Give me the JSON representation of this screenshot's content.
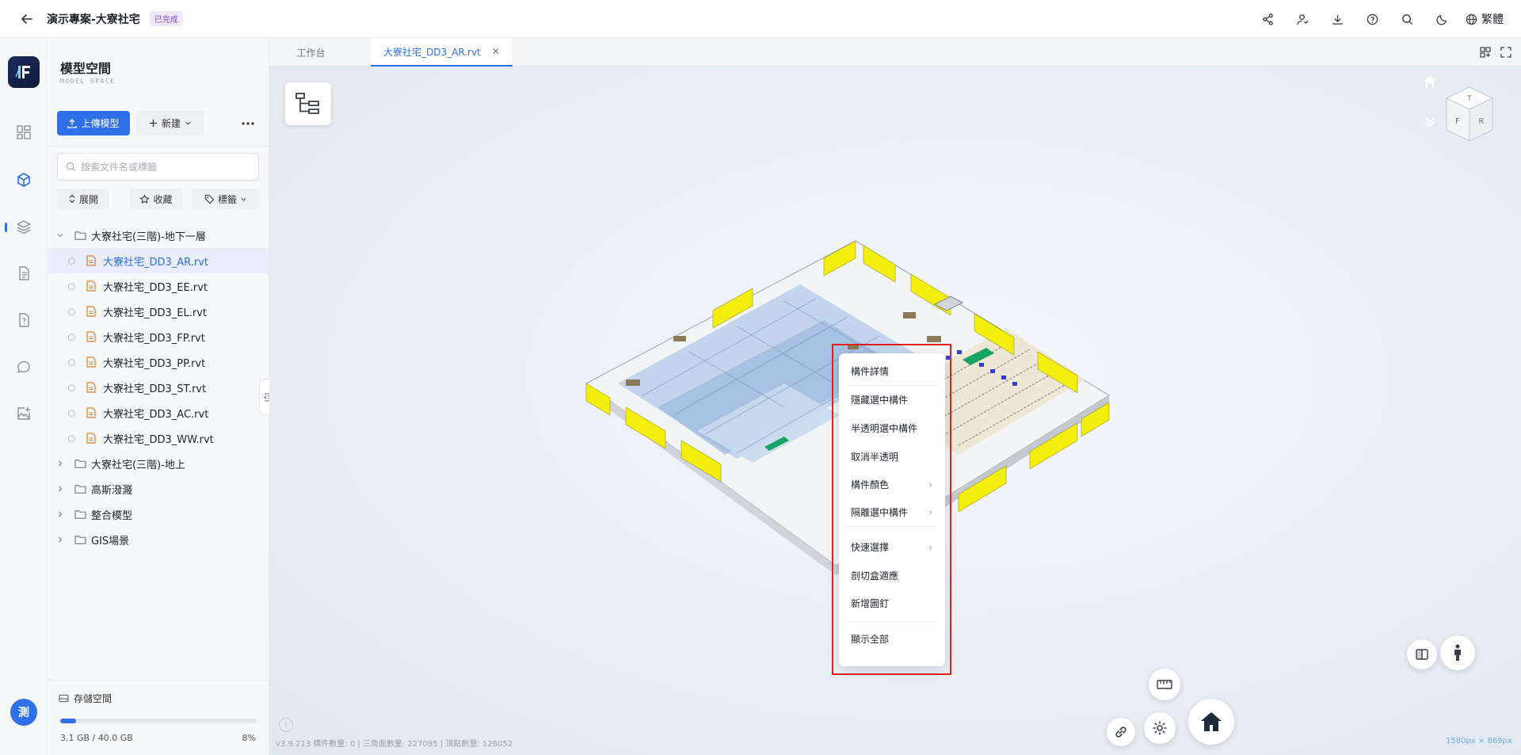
{
  "header": {
    "title": "演示專案-大寮社宅",
    "status": "已完成",
    "lang": "繁體"
  },
  "rail": {
    "avatar": "測"
  },
  "panel": {
    "title": "模型空間",
    "subtitle": "MODEL SPACE",
    "upload_label": "上傳模型",
    "new_label": "新建",
    "search_placeholder": "搜索文件名或標籤",
    "filters": {
      "expand": "展開",
      "favorite": "收藏",
      "tags": "標籤"
    },
    "tree": [
      {
        "type": "folder",
        "label": "大寮社宅(三階)-地下一層",
        "expanded": true
      },
      {
        "type": "file",
        "label": "大寮社宅_DD3_AR.rvt",
        "selected": true
      },
      {
        "type": "file",
        "label": "大寮社宅_DD3_EE.rvt"
      },
      {
        "type": "file",
        "label": "大寮社宅_DD3_EL.rvt"
      },
      {
        "type": "file",
        "label": "大寮社宅_DD3_FP.rvt"
      },
      {
        "type": "file",
        "label": "大寮社宅_DD3_PP.rvt"
      },
      {
        "type": "file",
        "label": "大寮社宅_DD3_ST.rvt"
      },
      {
        "type": "file",
        "label": "大寮社宅_DD3_AC.rvt"
      },
      {
        "type": "file",
        "label": "大寮社宅_DD3_WW.rvt"
      },
      {
        "type": "folder",
        "label": "大寮社宅(三階)-地上",
        "expanded": false
      },
      {
        "type": "folder",
        "label": "高斯潑濺",
        "expanded": false
      },
      {
        "type": "folder",
        "label": "整合模型",
        "expanded": false
      },
      {
        "type": "folder",
        "label": "GIS場景",
        "expanded": false
      }
    ],
    "storage": {
      "title": "存儲空間",
      "used": "3.1 GB / 40.0 GB",
      "percent_label": "8%",
      "percent": 8
    }
  },
  "tabs": [
    {
      "label": "工作台"
    },
    {
      "label": "大寮社宅_DD3_AR.rvt",
      "active": true
    }
  ],
  "context_menu": {
    "items": [
      {
        "label": "構件詳情"
      },
      {
        "label": "隱藏選中構件"
      },
      {
        "label": "半透明選中構件"
      },
      {
        "label": "取消半透明"
      },
      {
        "label": "構件顏色",
        "submenu": true
      },
      {
        "label": "隔離選中構件",
        "submenu": true
      },
      {
        "label": "快速選擇",
        "submenu": true
      },
      {
        "label": "剖切盒適應"
      },
      {
        "label": "新增圖釘"
      },
      {
        "label": "顯示全部"
      }
    ]
  },
  "viewcube": {
    "top": "T",
    "front": "F",
    "right": "R"
  },
  "status_bar": {
    "text": "v3.9.213    構件數量: 0 | 三角面數量: 227095 | 頂點數量: 126052"
  },
  "resolution_readout": "1580px × 869px",
  "colors": {
    "accent": "#2f6fe8",
    "highlight_box": "#e0201c",
    "file_icon": "#e07b24",
    "status_badge": "#7a4fd6"
  }
}
